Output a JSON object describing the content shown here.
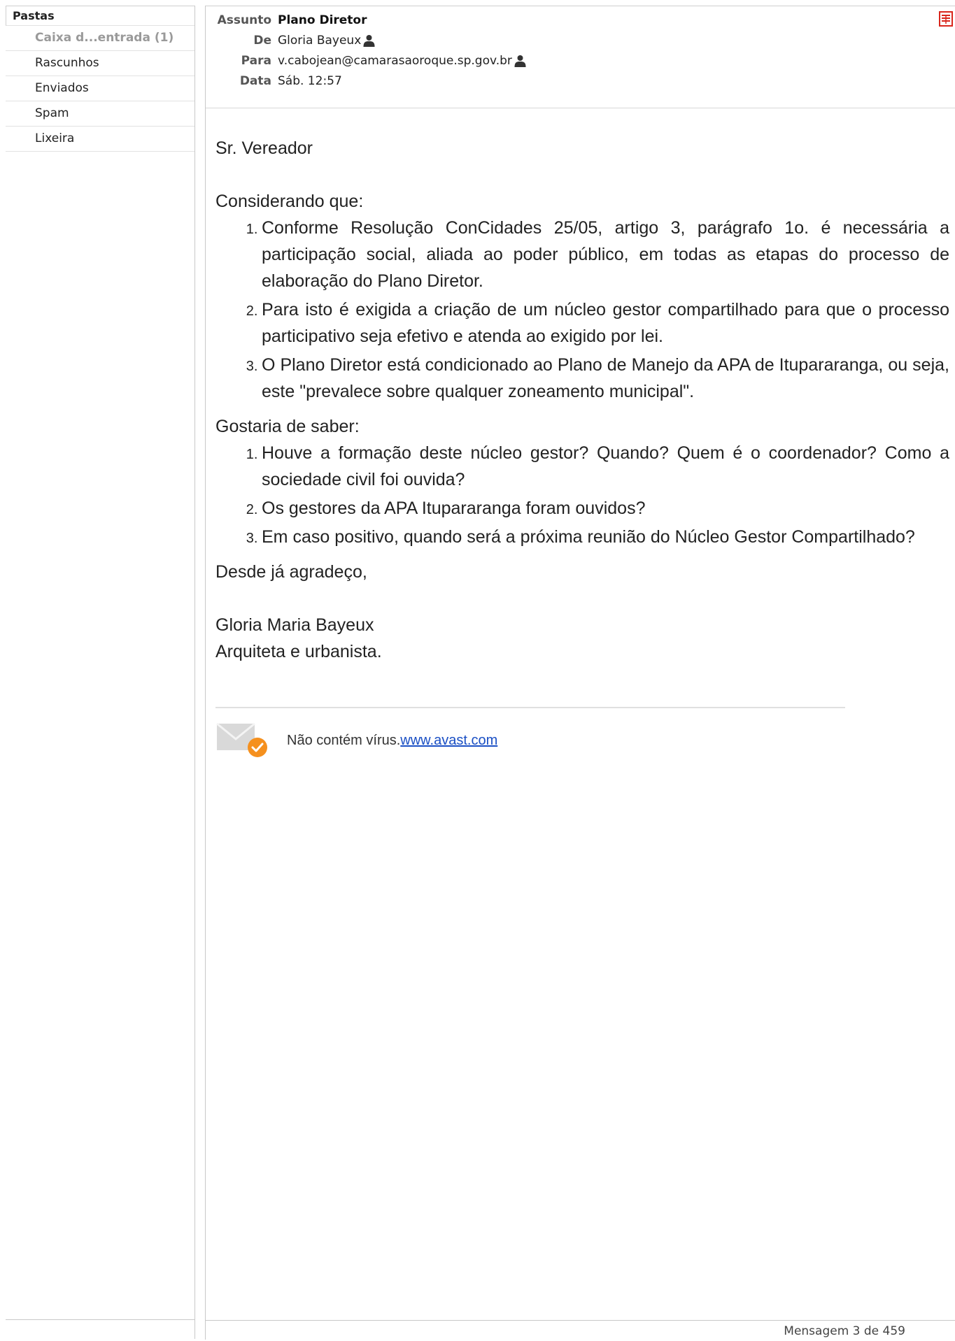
{
  "sidebar": {
    "title": "Pastas",
    "folders": [
      {
        "label": "Caixa d...entrada (1)",
        "active": true
      },
      {
        "label": "Rascunhos"
      },
      {
        "label": "Enviados"
      },
      {
        "label": "Spam"
      },
      {
        "label": "Lixeira"
      }
    ]
  },
  "message": {
    "subject_label": "Assunto",
    "subject": "Plano Diretor",
    "from_label": "De",
    "from": "Gloria Bayeux",
    "to_label": "Para",
    "to": "v.cabojean@camarasaoroque.sp.gov.br",
    "date_label": "Data",
    "date": "Sáb. 12:57"
  },
  "body": {
    "greeting": "Sr. Vereador",
    "considering": "Considerando que:",
    "considering_items": [
      "Conforme Resolução ConCidades 25/05, artigo 3, parágrafo 1o. é necessária a participação social, aliada ao poder público, em todas as etapas do processo de elaboração do Plano Diretor.",
      "Para isto é exigida a criação de um núcleo gestor compartilhado para que o processo participativo seja efetivo e atenda ao exigido por lei.",
      "O Plano Diretor está condicionado ao Plano de Manejo da APA de Itupararanga, ou seja, este \"prevalece sobre qualquer zoneamento municipal\"."
    ],
    "questions_intro": "Gostaria de saber:",
    "questions": [
      "Houve a formação deste núcleo gestor? Quando? Quem é o coordenador? Como a sociedade civil foi ouvida?",
      "Os gestores da APA Itupararanga foram ouvidos?",
      "Em caso positivo, quando será a próxima reunião do Núcleo Gestor Compartilhado?"
    ],
    "thanks": "Desde já agradeço,",
    "signature_name": "Gloria Maria Bayeux",
    "signature_title": "Arquiteta e urbanista.",
    "avast_text": "Não contém vírus.",
    "avast_link": "www.avast.com"
  },
  "footer": {
    "message_counter": "Mensagem 3 de 459"
  },
  "colors": {
    "accent_link": "#1a4fc4",
    "print_icon": "#d9261c",
    "avast_badge": "#f5901e"
  }
}
